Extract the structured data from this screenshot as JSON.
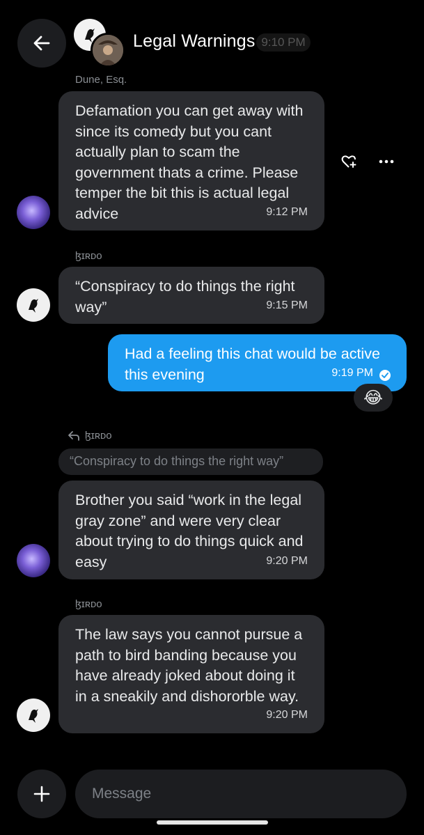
{
  "header": {
    "title": "Legal Warnings",
    "ghost_time": "9:10 PM",
    "back_icon": "arrow-left-icon"
  },
  "messages": [
    {
      "sender": "Dune, Esq.",
      "text": "Defamation you can get away with since its comedy but you cant actually plan to scam the government thats a crime. Please temper the bit this is actual legal advice",
      "time": "9:12 PM"
    },
    {
      "sender": "ɮɪʀᴅᴏ",
      "text": "“Conspiracy to do things the right way”",
      "time": "9:15 PM"
    },
    {
      "text": "Had a feeling this chat would be active this evening",
      "time": "9:19 PM",
      "reaction": "😂",
      "status": "read-check-icon"
    },
    {
      "reply_to_label": "ɮɪʀᴅᴏ",
      "quoted_text": "“Conspiracy to do things the right way”",
      "text": "Brother you said “work in the legal gray zone” and were very clear about trying to do things quick and easy",
      "time": "9:20 PM"
    },
    {
      "sender": "ɮɪʀᴅᴏ",
      "text": "The law says you cannot pursue a path to bird banding because you have already joked about doing it in a sneakily and dishororble way.",
      "time": "9:20 PM"
    }
  ],
  "composer": {
    "placeholder": "Message",
    "add_icon": "plus-icon"
  },
  "colors": {
    "background": "#000000",
    "bubble_other": "#2b2c30",
    "bubble_mine": "#1d9bf0"
  }
}
